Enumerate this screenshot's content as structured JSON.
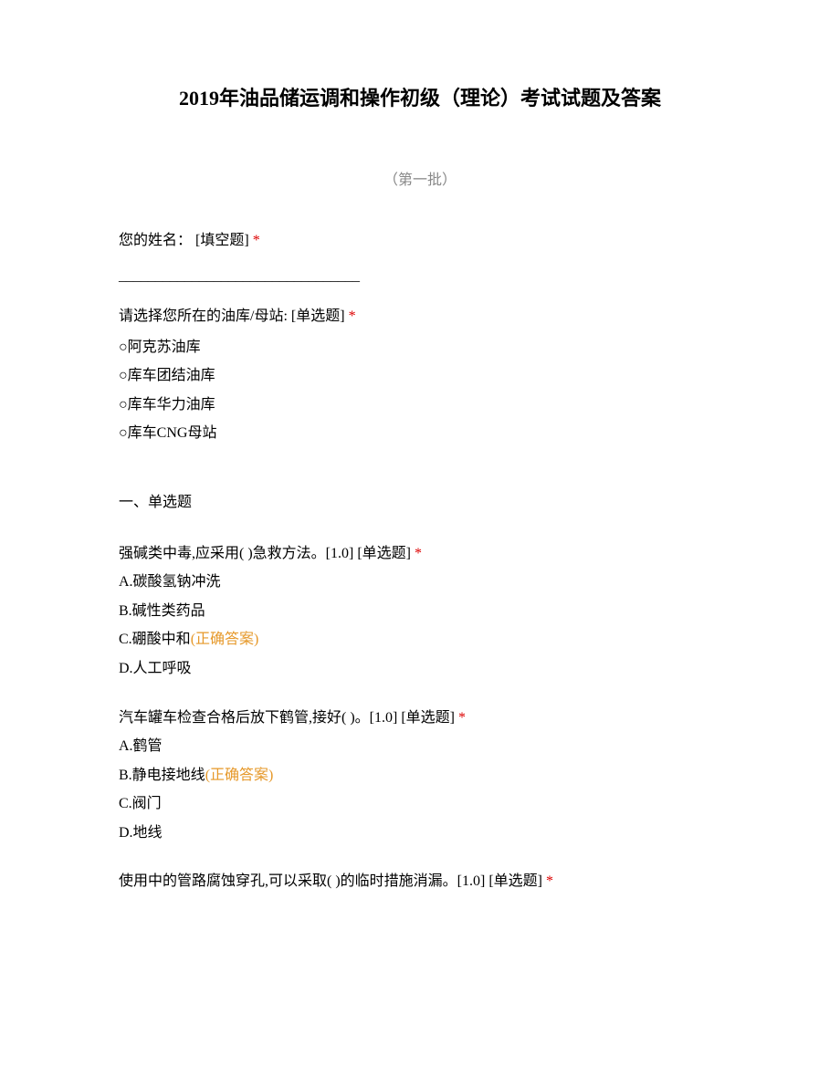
{
  "title": "2019年油品储运调和操作初级（理论）考试试题及答案",
  "subtitle": "（第一批）",
  "name_field": {
    "label": "您的姓名：",
    "type_tag": " [填空题] ",
    "required_mark": "*",
    "blank_line": "_________________________________"
  },
  "depot_field": {
    "label": "请选择您所在的油库/母站:",
    "type_tag": " [单选题] ",
    "required_mark": "*",
    "options": [
      "阿克苏油库",
      "库车团结油库",
      "库车华力油库",
      "库车CNG母站"
    ]
  },
  "section_heading": "一、单选题",
  "questions": [
    {
      "text": "强碱类中毒,应采用( )急救方法。[1.0] [单选题] ",
      "required_mark": "*",
      "options": [
        {
          "label": "A.碳酸氢钠冲洗",
          "correct_tag": ""
        },
        {
          "label": "B.碱性类药品",
          "correct_tag": ""
        },
        {
          "label": "C.硼酸中和",
          "correct_tag": "(正确答案)"
        },
        {
          "label": "D.人工呼吸",
          "correct_tag": ""
        }
      ]
    },
    {
      "text": "汽车罐车检查合格后放下鹤管,接好( )。[1.0] [单选题] ",
      "required_mark": "*",
      "options": [
        {
          "label": "A.鹤管",
          "correct_tag": ""
        },
        {
          "label": "B.静电接地线",
          "correct_tag": "(正确答案)"
        },
        {
          "label": "C.阀门",
          "correct_tag": ""
        },
        {
          "label": "D.地线",
          "correct_tag": ""
        }
      ]
    },
    {
      "text": "使用中的管路腐蚀穿孔,可以采取( )的临时措施消漏。[1.0] [单选题] ",
      "required_mark": "*",
      "options": []
    }
  ],
  "radio_marker": "○"
}
